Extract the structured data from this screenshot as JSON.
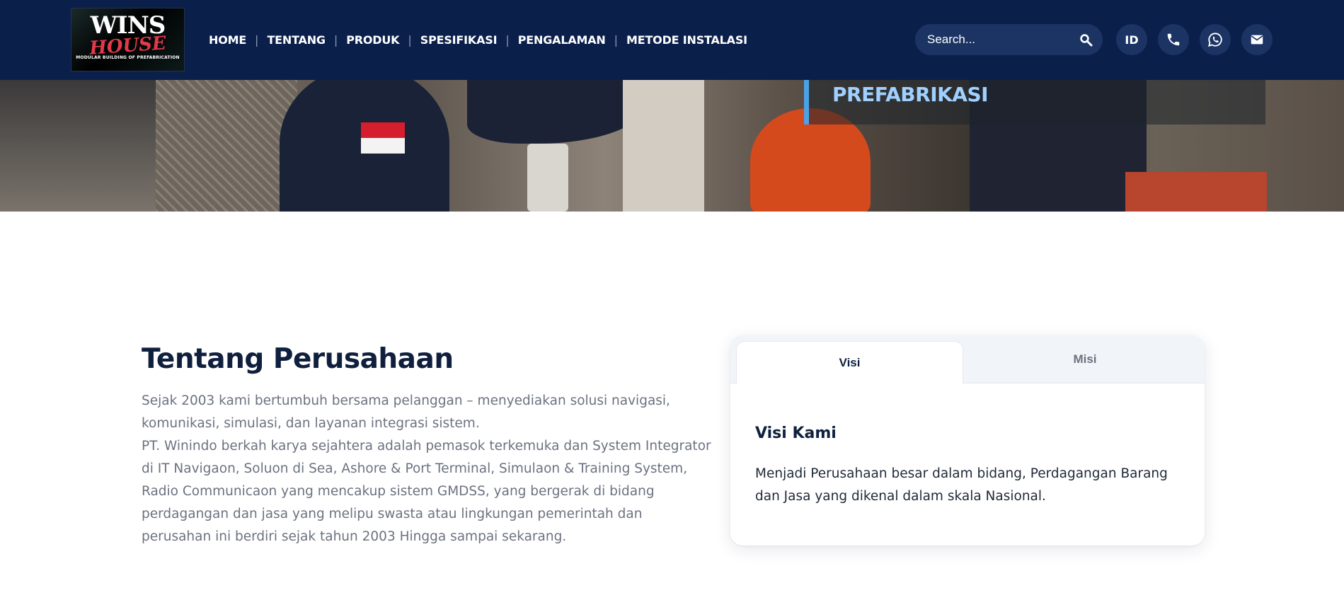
{
  "brand": {
    "logo_main": "WINS",
    "logo_sub": "HOUSE",
    "logo_tagline": "MODULAR BUILDING OF PREFABRICATION"
  },
  "nav": {
    "items": [
      {
        "label": "HOME"
      },
      {
        "label": "TENTANG"
      },
      {
        "label": "PRODUK"
      },
      {
        "label": "SPESIFIKASI"
      },
      {
        "label": "PENGALAMAN"
      },
      {
        "label": "METODE INSTALASI"
      }
    ],
    "separator": "|"
  },
  "search": {
    "placeholder": "Search...",
    "icon": "search-icon"
  },
  "header_actions": {
    "language_label": "ID",
    "phone_icon": "phone-icon",
    "whatsapp_icon": "whatsapp-icon",
    "email_icon": "mail-icon"
  },
  "hero": {
    "title": "PREFABRIKASI"
  },
  "about": {
    "title": "Tentang Perusahaan",
    "paragraph_1": "Sejak 2003 kami bertumbuh bersama pelanggan – menyediakan solusi navigasi, komunikasi, simulasi, dan layanan integrasi sistem.",
    "paragraph_2": "PT. Winindo berkah karya sejahtera adalah pemasok terkemuka dan System Integrator di IT Navigaon, Soluon di Sea, Ashore & Port Terminal, Simulaon & Training System, Radio Communicaon yang mencakup sistem GMDSS, yang bergerak di bidang perdagangan dan jasa yang melipu swasta atau lingkungan pemerintah dan perusahan ini berdiri sejak tahun 2003 Hingga sampai sekarang."
  },
  "tabs": {
    "items": [
      {
        "label": "Visi",
        "active": true
      },
      {
        "label": "Misi",
        "active": false
      }
    ],
    "panel": {
      "heading": "Visi Kami",
      "body": "Menjadi Perusahaan besar dalam bidang, Perdagangan Barang dan Jasa yang dikenal dalam skala Nasional."
    }
  },
  "colors": {
    "header_bg": "#0b1f4b",
    "accent_blue": "#4aa3e8",
    "heading_navy": "#0f1f3d",
    "logo_red": "#e23a4a"
  }
}
